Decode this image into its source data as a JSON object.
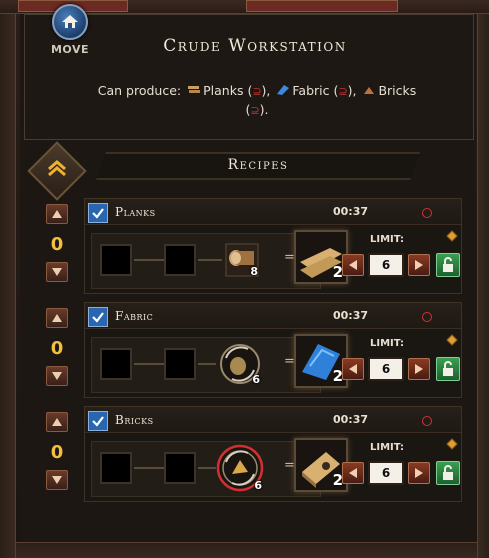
{
  "window": {
    "title": "Crude Workstation",
    "move_label": "MOVE"
  },
  "produce": {
    "prefix": "Can produce:",
    "items": [
      {
        "name": "Planks",
        "icon": "planks-icon"
      },
      {
        "name": "Fabric",
        "icon": "fabric-icon"
      },
      {
        "name": "Bricks",
        "icon": "bricks-icon"
      }
    ],
    "sep1": "),",
    "sep2": "),",
    "end": ")."
  },
  "recipes_header": "Recipes",
  "recipes": [
    {
      "name": "Planks",
      "time": "00:37",
      "queued": "0",
      "checked": true,
      "ingredient_count": "8",
      "output_count": "2",
      "limit_label": "LIMIT:",
      "limit_value": "6"
    },
    {
      "name": "Fabric",
      "time": "00:37",
      "queued": "0",
      "checked": true,
      "ingredient_count": "6",
      "output_count": "2",
      "limit_label": "LIMIT:",
      "limit_value": "6"
    },
    {
      "name": "Bricks",
      "time": "00:37",
      "queued": "0",
      "checked": true,
      "ingredient_count": "6",
      "output_count": "2",
      "limit_label": "LIMIT:",
      "limit_value": "6"
    }
  ],
  "colors": {
    "accent_gold": "#f0c040",
    "checkbox_blue": "#2a65b0",
    "lock_green": "#3aa050",
    "warning_red": "#d03030"
  }
}
